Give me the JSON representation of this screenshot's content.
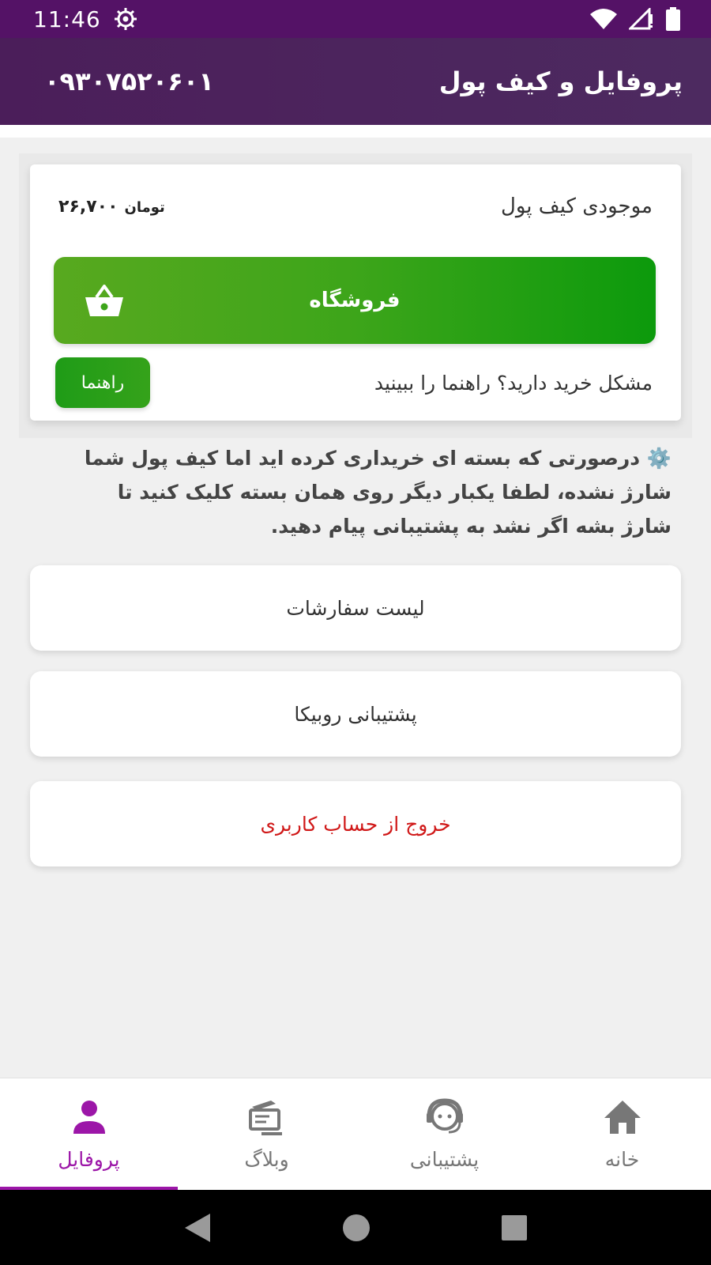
{
  "status_bar": {
    "time": "11:46",
    "icons": [
      "settings-icon",
      "wifi-icon",
      "signal-icon",
      "battery-icon"
    ]
  },
  "header": {
    "phone": "۰۹۳۰۷۵۲۰۶۰۱",
    "title": "پروفایل و کیف پول"
  },
  "wallet": {
    "label": "موجودی کیف پول",
    "balance": "۲۶,۷۰۰",
    "currency": "تومان",
    "shop_label": "فروشگاه",
    "help_text": "مشکل خرید دارید؟ راهنما را ببینید",
    "help_button": "راهنما"
  },
  "notice": {
    "icon": "⚙️",
    "text": "درصورتی که بسته ای خریداری کرده اید اما کیف پول شما شارژ نشده، لطفا یکبار دیگر روی همان بسته کلیک کنید تا شارژ بشه اگر نشد به پشتیبانی پیام دهید."
  },
  "menu": {
    "orders": "لیست سفارشات",
    "support": "پشتیبانی روبیکا",
    "logout": "خروج از حساب کاربری"
  },
  "bottom_nav": {
    "profile": "پروفایل",
    "blog": "وبلاگ",
    "support": "پشتیبانی",
    "home": "خانه"
  },
  "colors": {
    "status_bar": "#541266",
    "header": "#4b1e5a",
    "shop_green": "#3da51a",
    "logout_red": "#d01818",
    "nav_active": "#9c16a8"
  }
}
